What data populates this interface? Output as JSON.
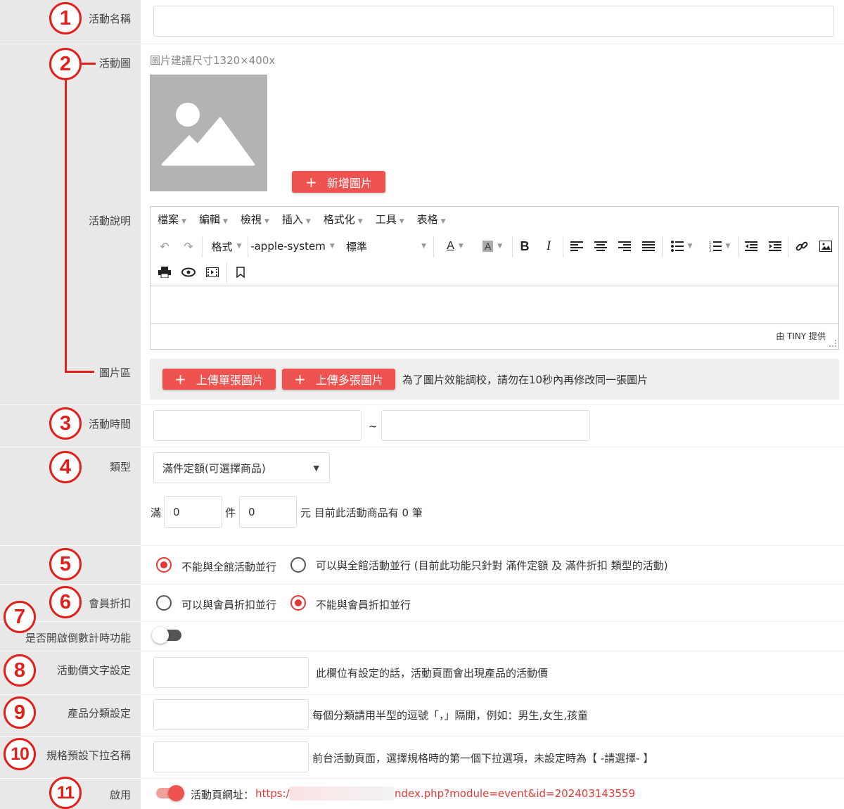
{
  "form": {
    "event_name": {
      "label": "活動名稱",
      "marker": "1",
      "value": ""
    },
    "event_image": {
      "label": "活動圖",
      "marker": "2",
      "hint": "圖片建議尺寸1320×400x",
      "placeholder_icon": "image-placeholder-icon",
      "add_button": "新增圖片"
    },
    "event_description": {
      "label": "活動說明",
      "editor": {
        "menus": [
          "檔案",
          "編輯",
          "檢視",
          "插入",
          "格式化",
          "工具",
          "表格"
        ],
        "format_label": "格式",
        "font_family": "-apple-system",
        "font_size": "標準",
        "footer_brand": "由 TINY 提供",
        "content": ""
      }
    },
    "image_area": {
      "label": "圖片區",
      "upload_single": "上傳單張圖片",
      "upload_multi": "上傳多張圖片",
      "hint": "為了圖片效能調校，請勿在10秒內再修改同一張圖片"
    },
    "event_time": {
      "label": "活動時間",
      "marker": "3",
      "separator": "~",
      "start": "",
      "end": ""
    },
    "type": {
      "label": "類型",
      "marker": "4",
      "selected": "滿件定額(可選擇商品)",
      "prefix": "滿",
      "count_value": "0",
      "count_unit": "件",
      "amount_value": "0",
      "suffix": "元 目前此活動商品有 0 筆"
    },
    "concurrency": {
      "marker": "5",
      "options": [
        {
          "label": "不能與全館活動並行",
          "selected": true
        },
        {
          "label": "可以與全館活動並行 (目前此功能只針對 滿件定額 及 滿件折扣 類型的活動)",
          "selected": false
        }
      ]
    },
    "member_discount": {
      "label": "會員折扣",
      "marker": "6",
      "options": [
        {
          "label": "可以與會員折扣並行",
          "selected": false
        },
        {
          "label": "不能與會員折扣並行",
          "selected": true
        }
      ]
    },
    "countdown": {
      "label": "是否開啟倒數計時功能",
      "marker": "7",
      "enabled": false
    },
    "price_text": {
      "label": "活動價文字設定",
      "marker": "8",
      "value": "",
      "hint": "此欄位有設定的話，活動頁面會出現產品的活動價"
    },
    "product_category": {
      "label": "產品分類設定",
      "marker": "9",
      "value": "",
      "hint": "每個分類請用半型的逗號「，」隔開，例如：男生,女生,孩童"
    },
    "spec_dropdown": {
      "label": "規格預設下拉名稱",
      "marker": "10",
      "value": "",
      "hint": "前台活動頁面，選擇規格時的第一個下拉選項，未設定時為【 -請選擇- 】"
    },
    "enable": {
      "label": "啟用",
      "marker": "11",
      "enabled": true,
      "url_label": "活動頁網址：",
      "url_start": "https:/",
      "url_end": "ndex.php?module=event&id=202403143559"
    }
  },
  "colors": {
    "accent": "#ef5350",
    "marker": "#e0201a",
    "label_bg": "#e8e8e8",
    "link": "#e53935"
  }
}
